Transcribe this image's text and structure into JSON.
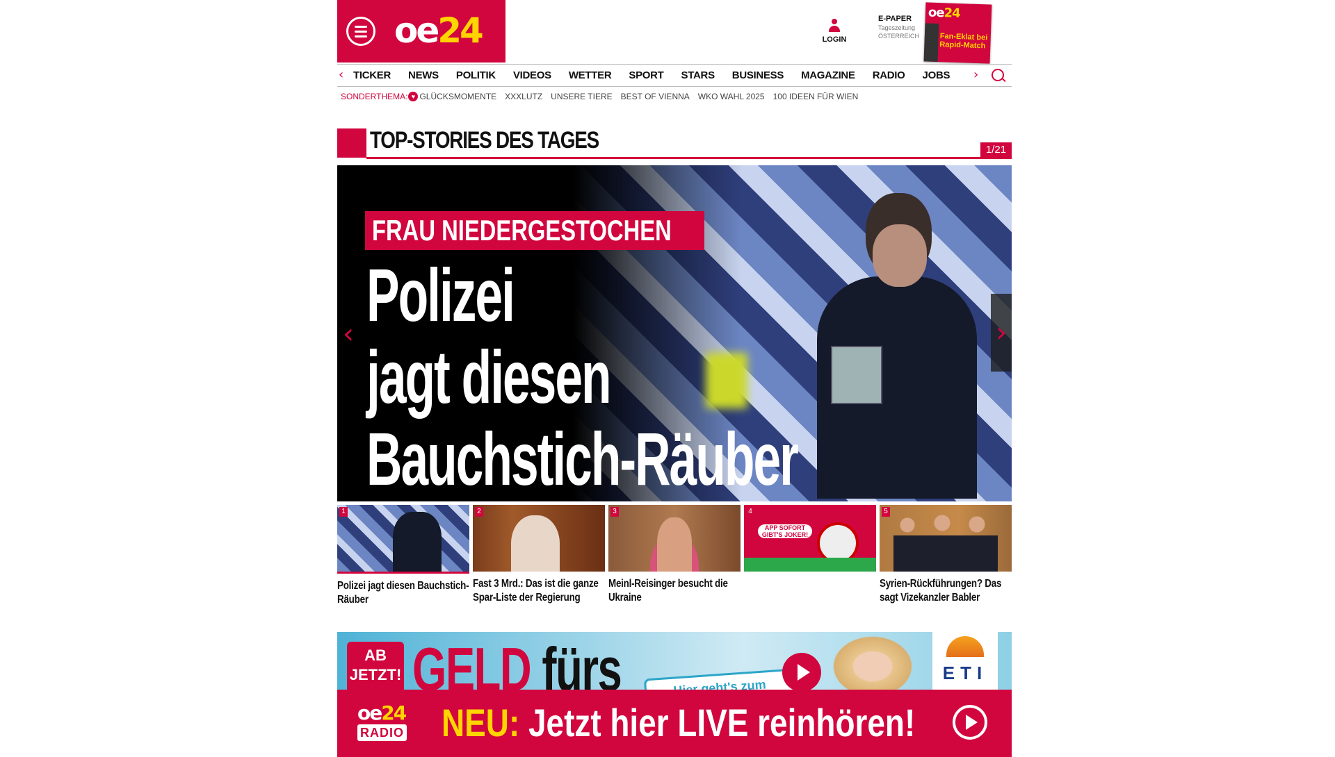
{
  "header": {
    "logo_oe": "oe",
    "logo_num": "24",
    "login_label": "LOGIN",
    "epaper": {
      "title": "E-PAPER",
      "line2": "Tageszeitung",
      "line3": "ÖSTERREICH",
      "cover_logo_oe": "oe",
      "cover_logo_num": "24",
      "cover_headline": "Fan-Eklat bei Rapid-Match"
    }
  },
  "nav": {
    "items": [
      "TICKER",
      "NEWS",
      "POLITIK",
      "VIDEOS",
      "WETTER",
      "SPORT",
      "STARS",
      "BUSINESS",
      "MAGAZINE",
      "RADIO",
      "JOBS"
    ]
  },
  "subnav": {
    "special_label": "SONDERTHEMA:",
    "items": [
      "GLÜCKSMOMENTE",
      "XXXLUTZ",
      "UNSERE TIERE",
      "BEST OF VIENNA",
      "WKO WAHL 2025",
      "100 IDEEN FÜR WIEN"
    ]
  },
  "top_stories": {
    "title": "TOP-STORIES DES TAGES",
    "counter": "1/21"
  },
  "hero": {
    "kicker": "FRAU NIEDERGESTOCHEN",
    "headline_line1": "Polizei",
    "headline_line2": "jagt diesen",
    "headline_line3": "Bauchstich-Räuber"
  },
  "thumbs": [
    {
      "num": "1",
      "caption": "Polizei jagt diesen Bauchstich-Räuber"
    },
    {
      "num": "2",
      "caption": "Fast 3 Mrd.: Das ist die ganze Spar-Liste der Regierung"
    },
    {
      "num": "3",
      "caption": "Meinl-Reisinger besucht die Ukraine"
    },
    {
      "num": "4",
      "caption": "",
      "ad_text": "APP SOFORT GIBT'S JOKER!"
    },
    {
      "num": "5",
      "caption": "Syrien-Rückführungen? Das sagt Vizekanzler Babler"
    }
  ],
  "ad": {
    "badge_line1": "AB",
    "badge_line2": "JETZT!",
    "geld": "GELD",
    "furs": " fürs",
    "hier": "Hier geht's zum",
    "eti": "ETI"
  },
  "radio": {
    "logo_oe": "oe",
    "logo_num": "24",
    "logo_radio": "RADIO",
    "neu": "NEU:",
    "message": " Jetzt hier LIVE reinhören!"
  },
  "colors": {
    "brand_red": "#d2063e",
    "brand_yellow": "#ffd400"
  }
}
